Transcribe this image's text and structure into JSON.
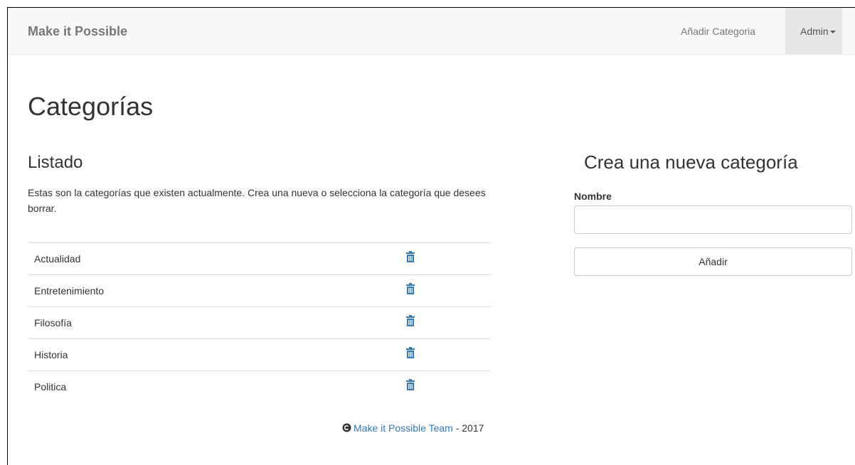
{
  "navbar": {
    "brand": "Make it Possible",
    "add_category_link": "Añadir Categoria",
    "user_menu": "Admin"
  },
  "page": {
    "title": "Categorías"
  },
  "listing": {
    "title": "Listado",
    "description": "Estas son la categorías que existen actualmente. Crea una nueva o selecciona la categoría que desees borrar.",
    "categories": [
      {
        "name": "Actualidad",
        "icon": "trash-icon"
      },
      {
        "name": "Entretenimiento",
        "icon": "trash-icon"
      },
      {
        "name": "Filosofía",
        "icon": "trash-icon"
      },
      {
        "name": "Historia",
        "icon": "trash-icon"
      },
      {
        "name": "Politica",
        "icon": "trash-icon"
      }
    ]
  },
  "form": {
    "title": "Crea una nueva categoría",
    "name_label": "Nombre",
    "name_value": "",
    "submit_label": "Añadir"
  },
  "footer": {
    "icon": "copyright-circle-icon",
    "team_link": "Make it Possible Team",
    "year_text": " - 2017"
  },
  "colors": {
    "link": "#337ab7",
    "navbar_bg": "#f8f8f8",
    "active_nav_bg": "#e7e7e7",
    "trash_icon": "#337ab7"
  }
}
